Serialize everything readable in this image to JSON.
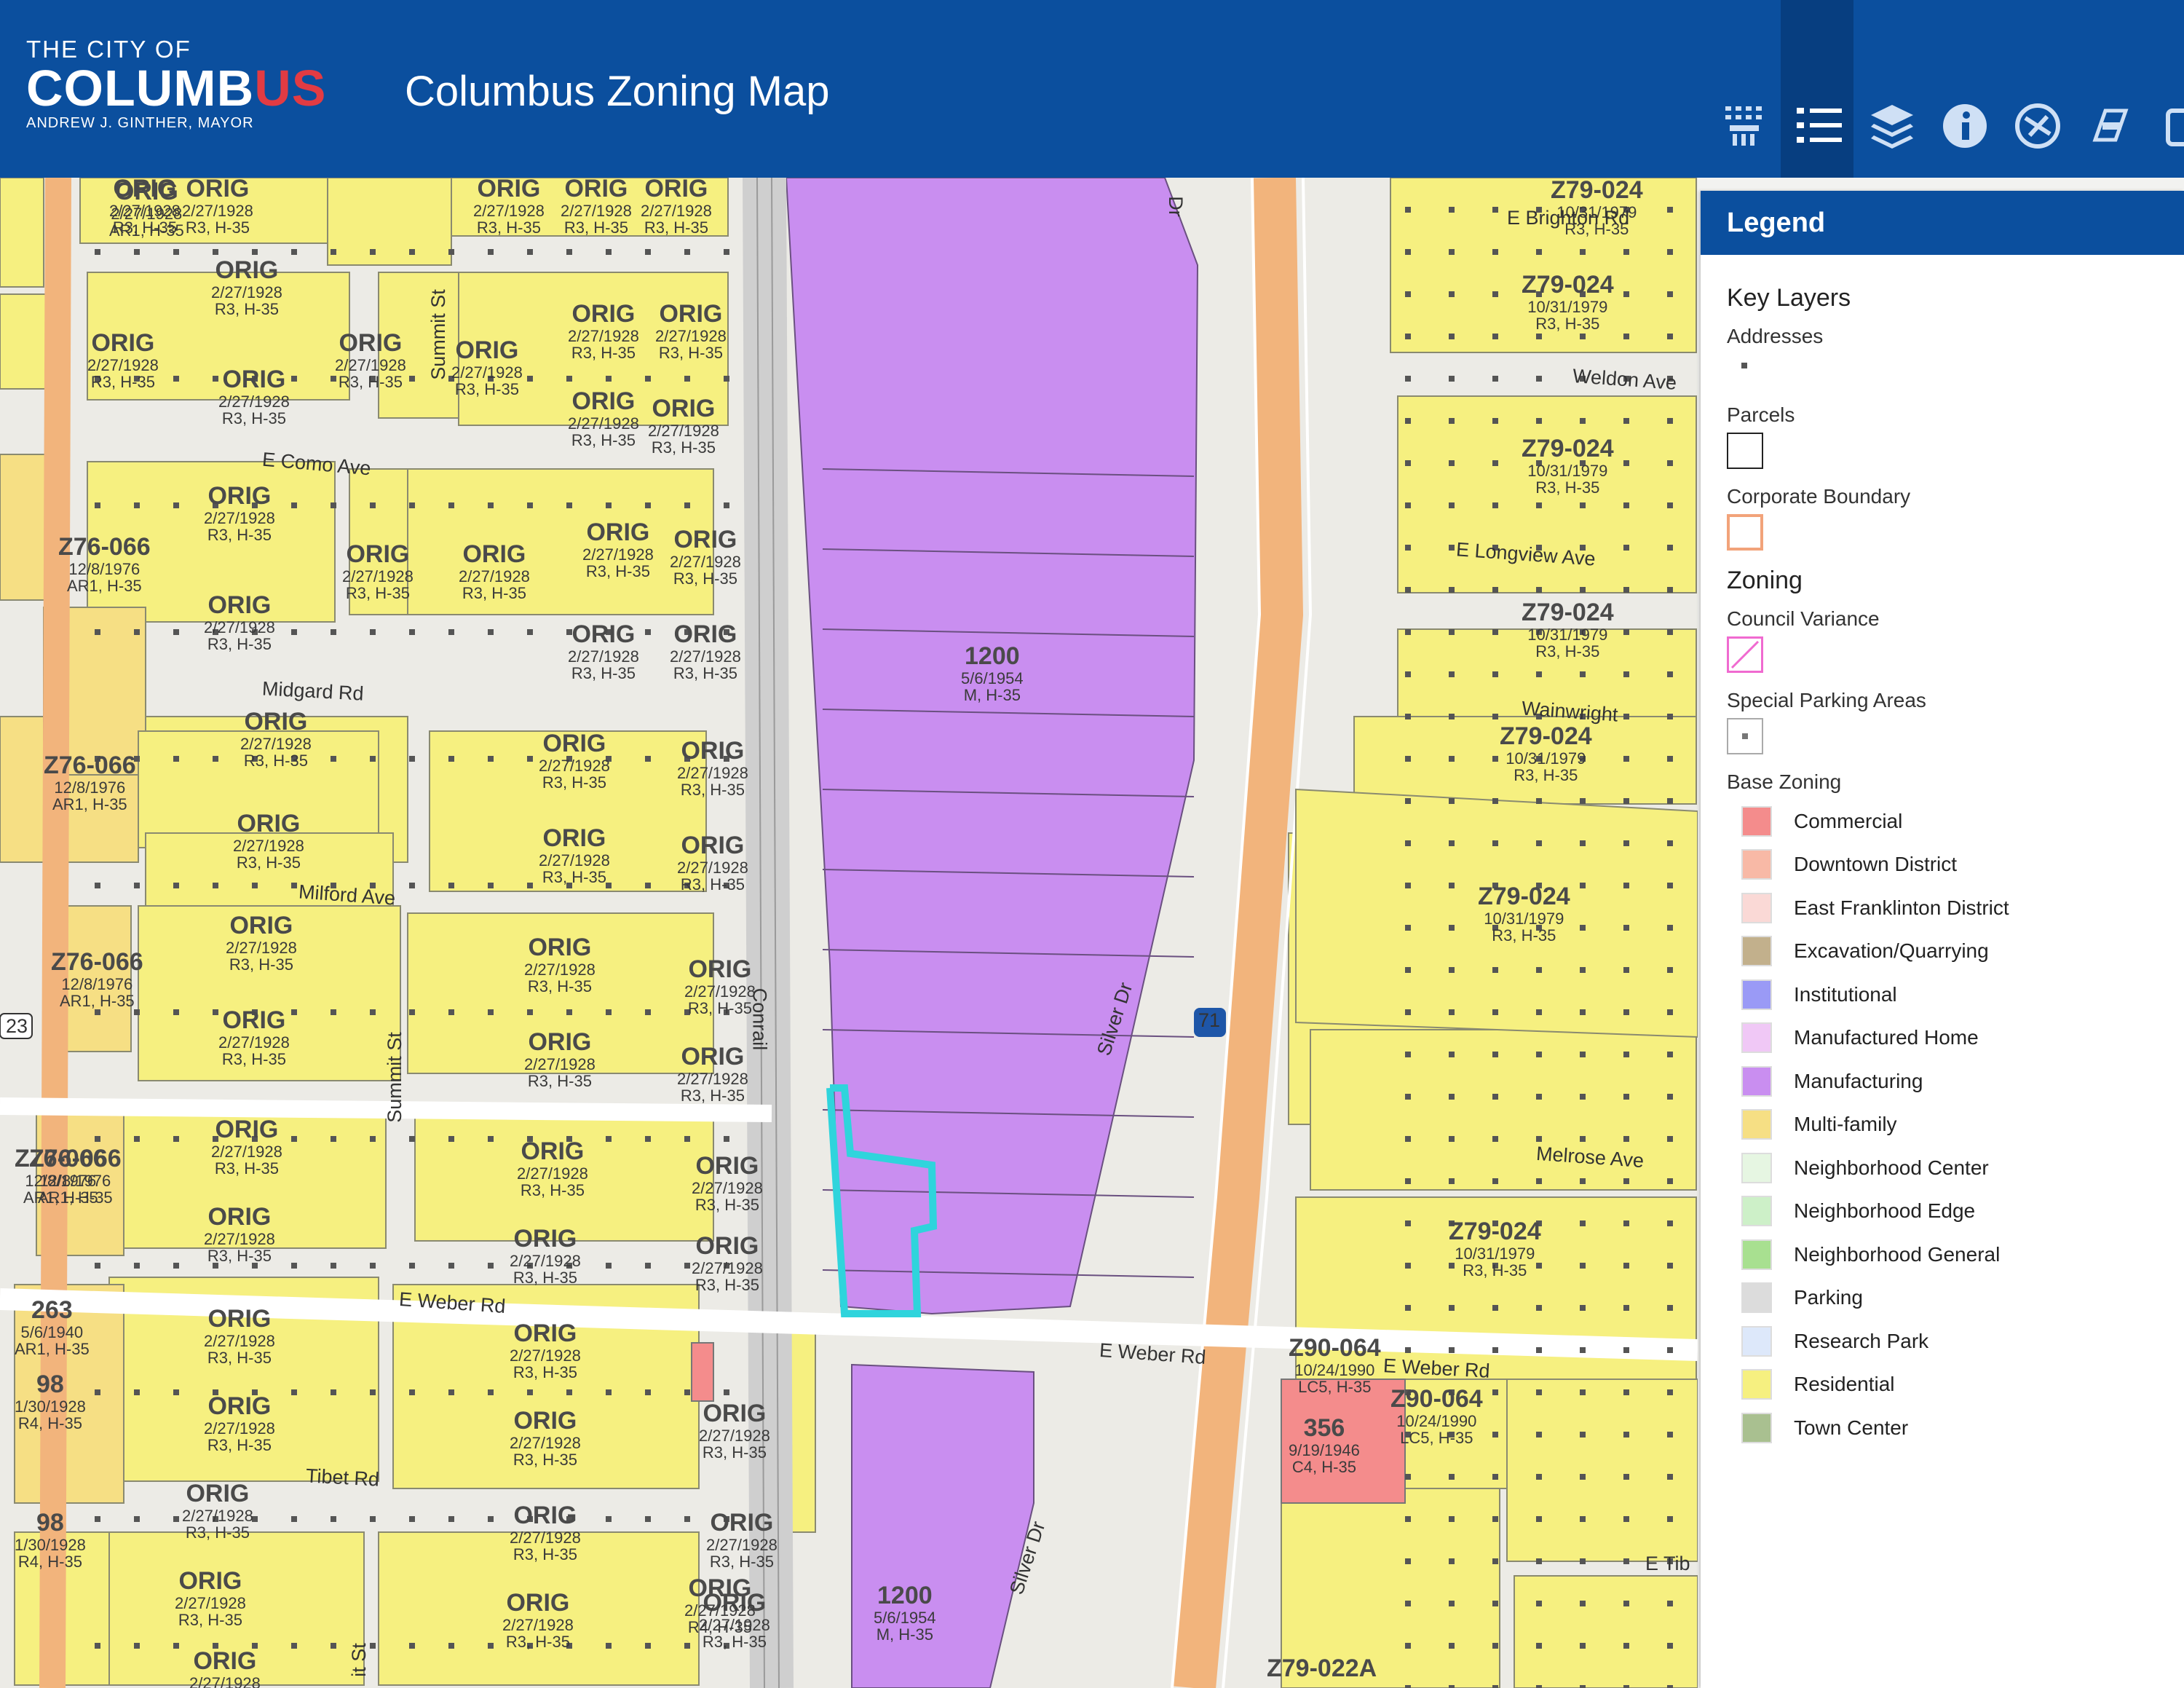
{
  "header": {
    "logo_line1": "THE CITY OF",
    "logo_main": "COLUMB",
    "logo_accent": "US",
    "logo_line3": "ANDREW J. GINTHER, MAYOR",
    "app_title": "Columbus Zoning Map"
  },
  "toolbar": [
    {
      "name": "basemap-gallery-icon",
      "active": false
    },
    {
      "name": "legend-list-icon",
      "active": true
    },
    {
      "name": "layers-icon",
      "active": false
    },
    {
      "name": "info-icon",
      "active": false
    },
    {
      "name": "measure-icon",
      "active": false
    },
    {
      "name": "print-icon",
      "active": false
    },
    {
      "name": "share-icon",
      "active": false
    }
  ],
  "legend": {
    "title": "Legend",
    "key_layers_title": "Key Layers",
    "addresses": "Addresses",
    "parcels": "Parcels",
    "corporate_boundary": "Corporate Boundary",
    "zoning_title": "Zoning",
    "council_variance": "Council Variance",
    "special_parking": "Special Parking Areas",
    "base_zoning": "Base Zoning",
    "items": [
      {
        "label": "Commercial",
        "color": "#f48c8c"
      },
      {
        "label": "Downtown District",
        "color": "#f8b9a6"
      },
      {
        "label": "East Franklinton District",
        "color": "#fad9d6"
      },
      {
        "label": "Excavation/Quarrying",
        "color": "#c2b08c"
      },
      {
        "label": "Institutional",
        "color": "#9a9af6"
      },
      {
        "label": "Manufactured Home",
        "color": "#f0c8f6"
      },
      {
        "label": "Manufacturing",
        "color": "#c98ef0"
      },
      {
        "label": "Multi-family",
        "color": "#f6df84"
      },
      {
        "label": "Neighborhood Center",
        "color": "#e6f6e2"
      },
      {
        "label": "Neighborhood Edge",
        "color": "#cdf0c8"
      },
      {
        "label": "Neighborhood General",
        "color": "#a8e090"
      },
      {
        "label": "Parking",
        "color": "#dcdcdc"
      },
      {
        "label": "Research Park",
        "color": "#dde8fa"
      },
      {
        "label": "Residential",
        "color": "#f6f080"
      },
      {
        "label": "Town Center",
        "color": "#a9c090"
      }
    ]
  },
  "map": {
    "streets": [
      "Summit St",
      "E Como Ave",
      "Midgard Rd",
      "Milford Ave",
      "Summit St",
      "E Weber Rd",
      "Tibet Rd",
      "Conrail",
      "Silver Dr",
      "Silver Dr",
      "Dr",
      "E Weber Rd",
      "E Weber Rd",
      "Weldon Ave",
      "E Longview Ave",
      "Wainwright",
      "Melrose Ave",
      "E Brighton Rd",
      "E Tib",
      "it St",
      "71",
      "23"
    ],
    "zoning_labels": [
      {
        "code": "ORIG",
        "date": "2/27/1928",
        "dist": "R3, H-35"
      },
      {
        "code": "Z76-066",
        "date": "12/8/1976",
        "dist": "AR1, H-35"
      },
      {
        "code": "1200",
        "date": "5/6/1954",
        "dist": "M, H-35"
      },
      {
        "code": "Z79-024",
        "date": "10/31/1979",
        "dist": "R3, H-35"
      },
      {
        "code": "Z90-064",
        "date": "10/24/1990",
        "dist": "LC5, H-35"
      },
      {
        "code": "356",
        "date": "9/19/1946",
        "dist": "C4, H-35"
      },
      {
        "code": "263",
        "date": "5/6/1940",
        "dist": "AR1, H-35"
      },
      {
        "code": "98",
        "date": "1/30/1928",
        "dist": "R4, H-35"
      },
      {
        "code": "Z79-022A",
        "date": "",
        "dist": ""
      },
      {
        "code": "ORIG",
        "date": "2/27/1928",
        "dist": "AR1, H-35"
      },
      {
        "code": "ORIG",
        "date": "2/27/1928",
        "dist": "R4, H-35"
      }
    ]
  }
}
